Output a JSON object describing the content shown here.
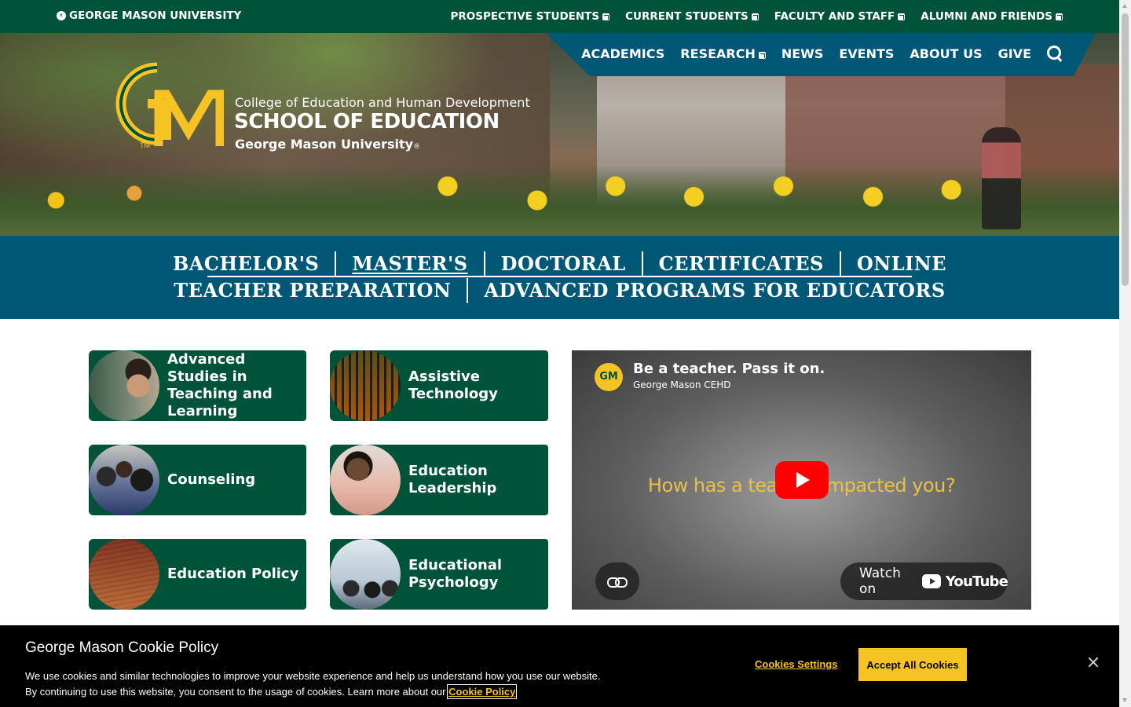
{
  "topbar": {
    "university_link": "GEORGE MASON UNIVERSITY",
    "links": [
      "PROSPECTIVE STUDENTS",
      "CURRENT STUDENTS",
      "FACULTY AND STAFF",
      "ALUMNI AND FRIENDS"
    ]
  },
  "main_nav": {
    "items": [
      "ACADEMICS",
      "RESEARCH",
      "NEWS",
      "EVENTS",
      "ABOUT US",
      "GIVE"
    ]
  },
  "logo": {
    "college": "College of Education and Human Development",
    "school": "SCHOOL OF EDUCATION",
    "university": "George Mason University",
    "registered": "®",
    "trademark": "TM",
    "mark": "GM"
  },
  "program_nav": {
    "row1": [
      "BACHELOR'S",
      "MASTER'S",
      "DOCTORAL",
      "CERTIFICATES",
      "ONLINE"
    ],
    "row2": [
      "TEACHER PREPARATION",
      "ADVANCED PROGRAMS FOR EDUCATORS"
    ],
    "active": "MASTER'S"
  },
  "programs": [
    {
      "label": "Advanced Studies in Teaching and Learning",
      "image_icon": "teacher-photo"
    },
    {
      "label": "Assistive Technology",
      "image_icon": "keyboard-photo"
    },
    {
      "label": "Counseling",
      "image_icon": "group-photo"
    },
    {
      "label": "Education Leadership",
      "image_icon": "leader-photo"
    },
    {
      "label": "Education Policy",
      "image_icon": "book-photo"
    },
    {
      "label": "Educational Psychology",
      "image_icon": "classroom-photo"
    }
  ],
  "video": {
    "title": "Be a teacher. Pass it on.",
    "channel": "George Mason CEHD",
    "caption_left": "How has a tea",
    "caption_right": "mpacted you?",
    "watch_on": "Watch on",
    "youtube": "YouTube"
  },
  "cookie": {
    "title": "George Mason Cookie Policy",
    "text": "We use cookies and similar technologies to improve your website experience and help us understand how you use our website. By continuing to use this website, you consent to the usage of cookies. Learn more about our",
    "policy_link": "Cookie Policy",
    "settings": "Cookies Settings",
    "accept": "Accept All Cookies"
  },
  "colors": {
    "mason_green": "#005239",
    "blue": "#005876",
    "gold": "#f6c325"
  }
}
